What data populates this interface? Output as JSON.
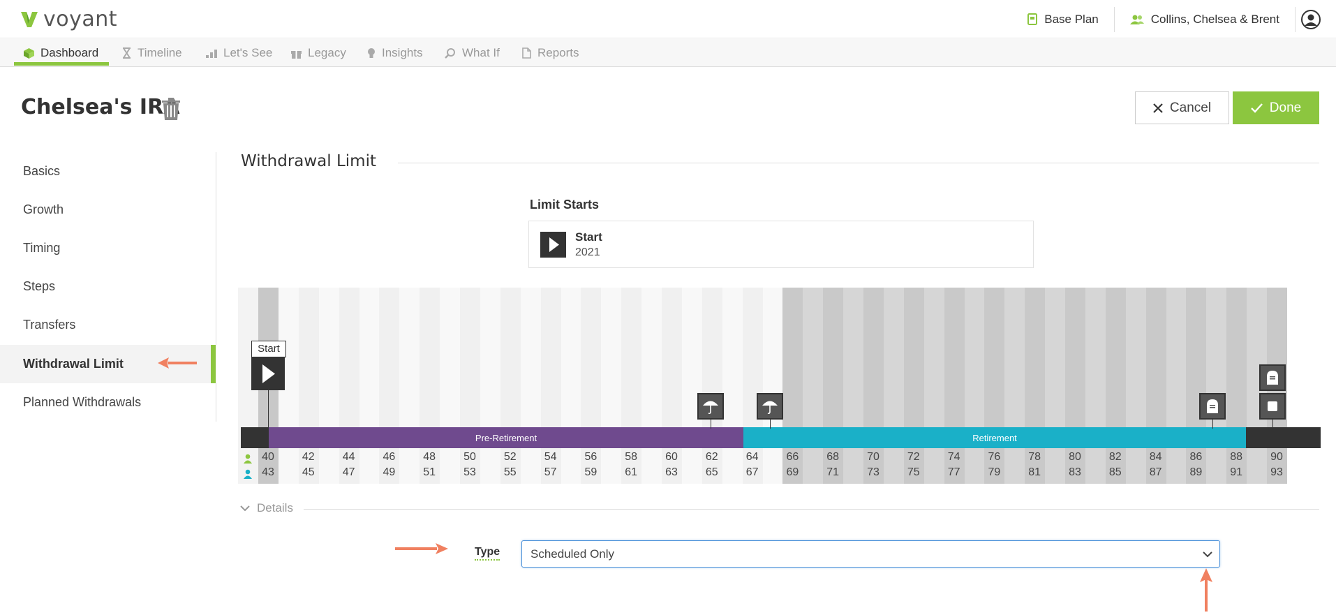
{
  "header": {
    "logo_text": "voyant",
    "plan_label": "Base Plan",
    "client_label": "Collins, Chelsea & Brent"
  },
  "nav": {
    "items": [
      {
        "label": "Dashboard",
        "icon": "cube-icon",
        "active": true
      },
      {
        "label": "Timeline",
        "icon": "hourglass-icon",
        "active": false
      },
      {
        "label": "Let's See",
        "icon": "bar-chart-icon",
        "active": false
      },
      {
        "label": "Legacy",
        "icon": "gift-icon",
        "active": false
      },
      {
        "label": "Insights",
        "icon": "lightbulb-icon",
        "active": false
      },
      {
        "label": "What If",
        "icon": "magnifier-icon",
        "active": false
      },
      {
        "label": "Reports",
        "icon": "document-icon",
        "active": false
      }
    ]
  },
  "page": {
    "title": "Chelsea's IRA",
    "cancel_label": "Cancel",
    "done_label": "Done"
  },
  "sidebar": {
    "items": [
      {
        "label": "Basics"
      },
      {
        "label": "Growth"
      },
      {
        "label": "Timing"
      },
      {
        "label": "Steps"
      },
      {
        "label": "Transfers"
      },
      {
        "label": "Withdrawal Limit"
      },
      {
        "label": "Planned Withdrawals"
      }
    ],
    "active_index": 5
  },
  "section": {
    "title": "Withdrawal Limit",
    "limit_starts_label": "Limit Starts",
    "limit_name": "Start",
    "limit_year": "2021"
  },
  "timeline": {
    "start_tag": "Start",
    "pre_label": "Pre-Retirement",
    "ret_label": "Retirement",
    "person1_ages": [
      "40",
      "42",
      "44",
      "46",
      "48",
      "50",
      "52",
      "54",
      "56",
      "58",
      "60",
      "62",
      "64",
      "66",
      "68",
      "70",
      "72",
      "74",
      "76",
      "78",
      "80",
      "82",
      "84",
      "86",
      "88",
      "90"
    ],
    "person2_ages": [
      "43",
      "45",
      "47",
      "49",
      "51",
      "53",
      "55",
      "57",
      "59",
      "61",
      "63",
      "65",
      "67",
      "69",
      "71",
      "73",
      "75",
      "77",
      "79",
      "81",
      "83",
      "85",
      "87",
      "89",
      "91",
      "93"
    ],
    "colors": {
      "pre": "#6f4a8e",
      "retirement": "#1ab0c8",
      "accent": "#8cc63f"
    }
  },
  "details": {
    "label": "Details",
    "type_label": "Type",
    "type_value": "Scheduled Only"
  }
}
